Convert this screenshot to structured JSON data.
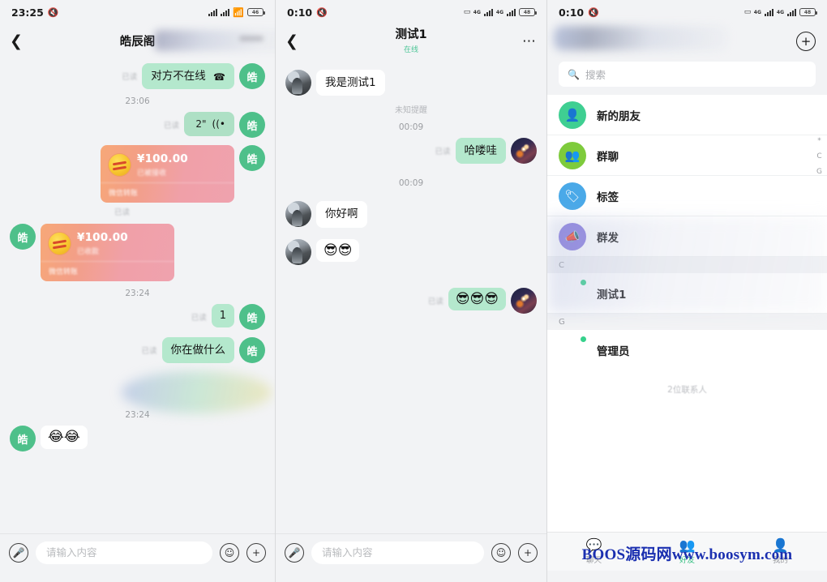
{
  "colors": {
    "accent_green": "#36c083",
    "bubble_out": "#b4e8cd",
    "bubble_in": "#ffffff",
    "page_bg": "#f2f3f5",
    "watermark": "#1a2fb0"
  },
  "panel_left": {
    "status": {
      "time": "23:25",
      "mute_icon": "mute-icon",
      "signal_icon": "signal-icon",
      "wifi_icon": "wifi-icon",
      "battery": "46"
    },
    "header": {
      "back_icon": "back-chevron-icon",
      "title": "皓辰阁"
    },
    "messages": [
      {
        "type": "text",
        "side": "out",
        "text": "对方不在线",
        "icon": "phone-icon",
        "read": "已读",
        "avatar": "皓"
      },
      {
        "type": "time",
        "text": "23:06"
      },
      {
        "type": "voice",
        "side": "out",
        "duration": "2\"",
        "icon": "voice-wave-icon",
        "read": "已读",
        "avatar": "皓"
      },
      {
        "type": "transfer",
        "side": "out",
        "amount": "¥100.00",
        "state": "已被接收",
        "footer": "微信转账",
        "read": "已读",
        "avatar": "皓"
      },
      {
        "type": "transfer",
        "side": "in",
        "amount": "¥100.00",
        "state": "已收款",
        "footer": "微信转账",
        "avatar": "皓"
      },
      {
        "type": "time",
        "text": "23:24"
      },
      {
        "type": "badge",
        "side": "out",
        "text": "1",
        "read": "已读",
        "avatar": "皓"
      },
      {
        "type": "text",
        "side": "out",
        "text": "你在做什么",
        "read": "已读",
        "avatar": "皓"
      },
      {
        "type": "time",
        "text": "23:24"
      },
      {
        "type": "emoji",
        "side": "in",
        "text": "😂😂",
        "avatar": "皓"
      }
    ],
    "input": {
      "mic_icon": "microphone-icon",
      "placeholder": "请输入内容",
      "emoji_icon": "smiley-icon",
      "plus_icon": "plus-icon"
    }
  },
  "panel_middle": {
    "status": {
      "time": "0:10",
      "mute_icon": "mute-icon",
      "card_icon": "sim-icon",
      "net1": "4G",
      "net2": "4G",
      "battery": "48"
    },
    "header": {
      "back_icon": "back-chevron-icon",
      "title": "测试1",
      "subtitle": "在线",
      "more_icon": "more-dots-icon"
    },
    "messages": [
      {
        "type": "text",
        "side": "in",
        "text": "我是测试1",
        "avatar": "photo"
      },
      {
        "type": "note",
        "text": "未知提醒"
      },
      {
        "type": "time",
        "text": "00:09"
      },
      {
        "type": "text",
        "side": "out",
        "text": "哈喽哇",
        "read": "已读",
        "avatar": "space"
      },
      {
        "type": "time",
        "text": "00:09"
      },
      {
        "type": "text",
        "side": "in",
        "text": "你好啊",
        "avatar": "photo"
      },
      {
        "type": "emoji",
        "side": "in",
        "text": "😎😎",
        "avatar": "photo"
      },
      {
        "type": "emoji",
        "side": "out",
        "text": "😎😎😎",
        "read": "已读",
        "avatar": "space"
      }
    ],
    "input": {
      "mic_icon": "microphone-icon",
      "placeholder": "请输入内容",
      "emoji_icon": "smiley-icon",
      "plus_icon": "plus-icon"
    }
  },
  "panel_right": {
    "status": {
      "time": "0:10",
      "mute_icon": "mute-icon",
      "card_icon": "sim-icon",
      "net1": "4G",
      "net2": "4G",
      "battery": "48"
    },
    "header": {
      "add_icon": "plus-circle-icon"
    },
    "search": {
      "icon": "search-icon",
      "placeholder": "搜索"
    },
    "entries": [
      {
        "label": "新的朋友",
        "icon": "new-friend-icon",
        "color": "#3fcf92"
      },
      {
        "label": "群聊",
        "icon": "group-chat-icon",
        "color": "#7ecb3c"
      },
      {
        "label": "标签",
        "icon": "tag-icon",
        "color": "#4aa9e8"
      },
      {
        "label": "群发",
        "icon": "broadcast-icon",
        "color": "#8b7ee0"
      }
    ],
    "sections": [
      {
        "letter": "C",
        "contacts": [
          {
            "name": "测试1",
            "avatar": "photo",
            "online": true
          }
        ]
      },
      {
        "letter": "G",
        "contacts": [
          {
            "name": "管理员",
            "avatar": "space",
            "online": true
          }
        ]
      }
    ],
    "alpha_index": [
      "*",
      "C",
      "G"
    ],
    "count_note": "2位联系人",
    "tabs": [
      {
        "label": "聊天",
        "icon": "chat-icon",
        "active": false
      },
      {
        "label": "好友",
        "icon": "friends-icon",
        "active": true
      },
      {
        "label": "我的",
        "icon": "profile-icon",
        "active": false
      }
    ],
    "watermark": "BOOS源码网www.boosym.com"
  }
}
